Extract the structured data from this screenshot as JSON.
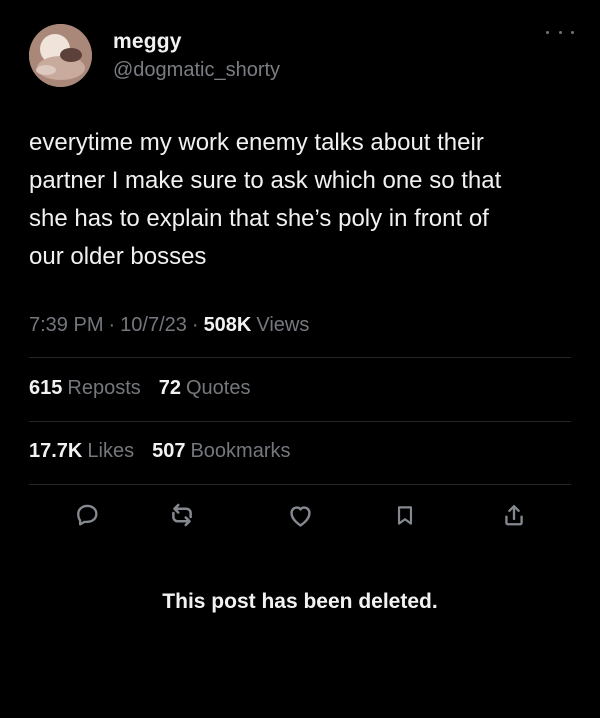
{
  "author": {
    "display_name": "meggy",
    "handle": "@dogmatic_shorty"
  },
  "post": {
    "text": "everytime my work enemy talks about their\npartner I make sure to ask which one so that\nshe has to explain that she’s poly in front of\nour older bosses",
    "time": "7:39 PM",
    "date": "10/7/23",
    "views_count": "508K",
    "views_label": "Views"
  },
  "stats": {
    "reposts_count": "615",
    "reposts_label": "Reposts",
    "quotes_count": "72",
    "quotes_label": "Quotes",
    "likes_count": "17.7K",
    "likes_label": "Likes",
    "bookmarks_count": "507",
    "bookmarks_label": "Bookmarks"
  },
  "actions": {
    "icons": [
      "reply-icon",
      "repost-icon",
      "like-icon",
      "bookmark-icon",
      "share-icon"
    ]
  },
  "status": {
    "deleted_message": "This post has been deleted."
  },
  "colors": {
    "background": "#000000",
    "primary_text": "#f2f2f2",
    "secondary_text": "#74787d",
    "divider": "#22252a"
  },
  "ui_icons": {
    "more": "more-icon"
  }
}
